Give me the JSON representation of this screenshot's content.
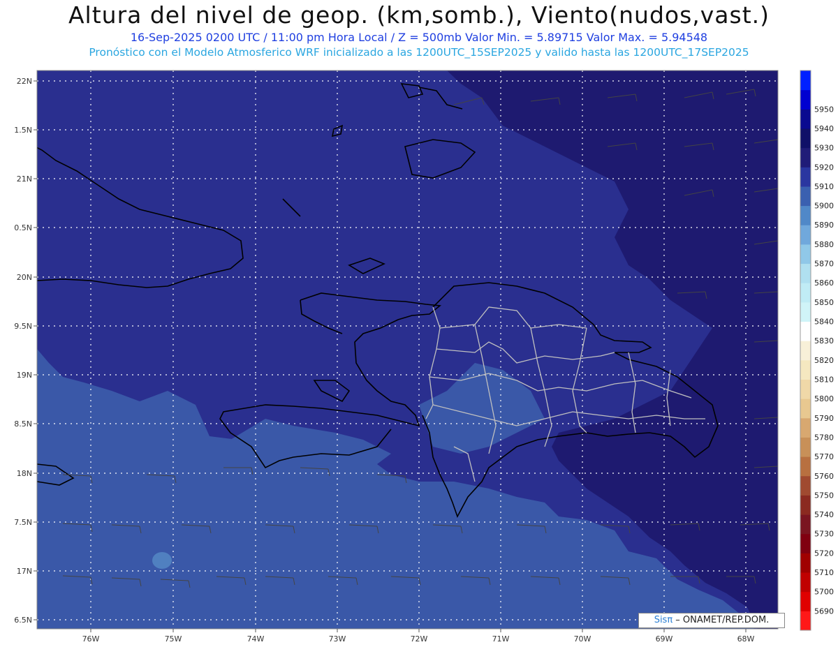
{
  "header": {
    "title": "Altura del nivel de geop. (km,somb.), Viento(nudos,vast.)",
    "line1": "16-Sep-2025  0200 UTC / 11:00 pm Hora Local / Z = 500mb     Valor Min. = 5.89715  Valor Max. = 5.94548",
    "line2": "Pronóstico con el Modelo Atmosferico WRF inicializado a las 1200UTC_15SEP2025 y valido hasta las  1200UTC_17SEP2025"
  },
  "axes": {
    "lat_labels": [
      "22N",
      "1.5N",
      "21N",
      "0.5N",
      "20N",
      "9.5N",
      "19N",
      "8.5N",
      "18N",
      "7.5N",
      "17N",
      "6.5N"
    ],
    "lon_labels": [
      "76W",
      "75W",
      "74W",
      "73W",
      "72W",
      "71W",
      "70W",
      "69W",
      "68W"
    ]
  },
  "colorbar": {
    "levels": [
      5690,
      5700,
      5710,
      5720,
      5730,
      5740,
      5750,
      5760,
      5770,
      5780,
      5790,
      5800,
      5810,
      5820,
      5830,
      5840,
      5850,
      5860,
      5870,
      5880,
      5890,
      5900,
      5910,
      5920,
      5930,
      5940,
      5950
    ],
    "colors": [
      "#ff1818",
      "#e00000",
      "#c00000",
      "#a00000",
      "#800010",
      "#7a1520",
      "#8b2a20",
      "#a04a30",
      "#b87040",
      "#c89058",
      "#d8a870",
      "#e8c890",
      "#f0d8a8",
      "#f5e8c0",
      "#f8f0d8",
      "#ffffff",
      "#d0f4f8",
      "#c0ecf5",
      "#b0e0f0",
      "#90c8e8",
      "#70a8dc",
      "#5088c8",
      "#3a60b0",
      "#2a36a0",
      "#201c78",
      "#101068",
      "#0a0a90",
      "#0000d0",
      "#0020ff"
    ]
  },
  "map": {
    "colors": {
      "fill_5910": "#2a2f8f",
      "fill_5900": "#3a58a8",
      "fill_5920": "#1e1a70",
      "fill_5890": "#5080c0",
      "coast": "#000000",
      "province": "#c0c0c0",
      "grid": "#ffffff",
      "barb": "#444444"
    }
  },
  "credit": {
    "sis": "Sisπ",
    "text": " – ONAMET/REP.DOM."
  }
}
